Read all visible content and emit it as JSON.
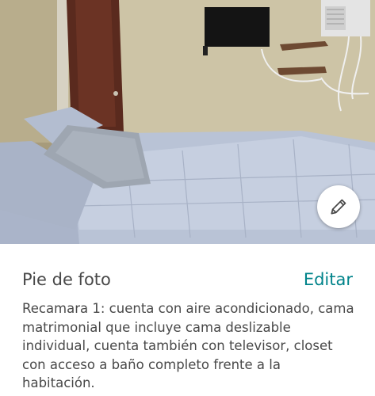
{
  "photo": {
    "alt_icon": "bedroom-photo",
    "edit_icon": "pencil-icon"
  },
  "caption": {
    "title": "Pie de foto",
    "action_label": "Editar",
    "text": "Recamara 1: cuenta con aire acondicionado, cama matrimonial que incluye cama deslizable individual, cuenta también con televisor, closet con acceso a baño completo frente a la habitación."
  },
  "colors": {
    "accent": "#00838a",
    "text": "#484848"
  }
}
